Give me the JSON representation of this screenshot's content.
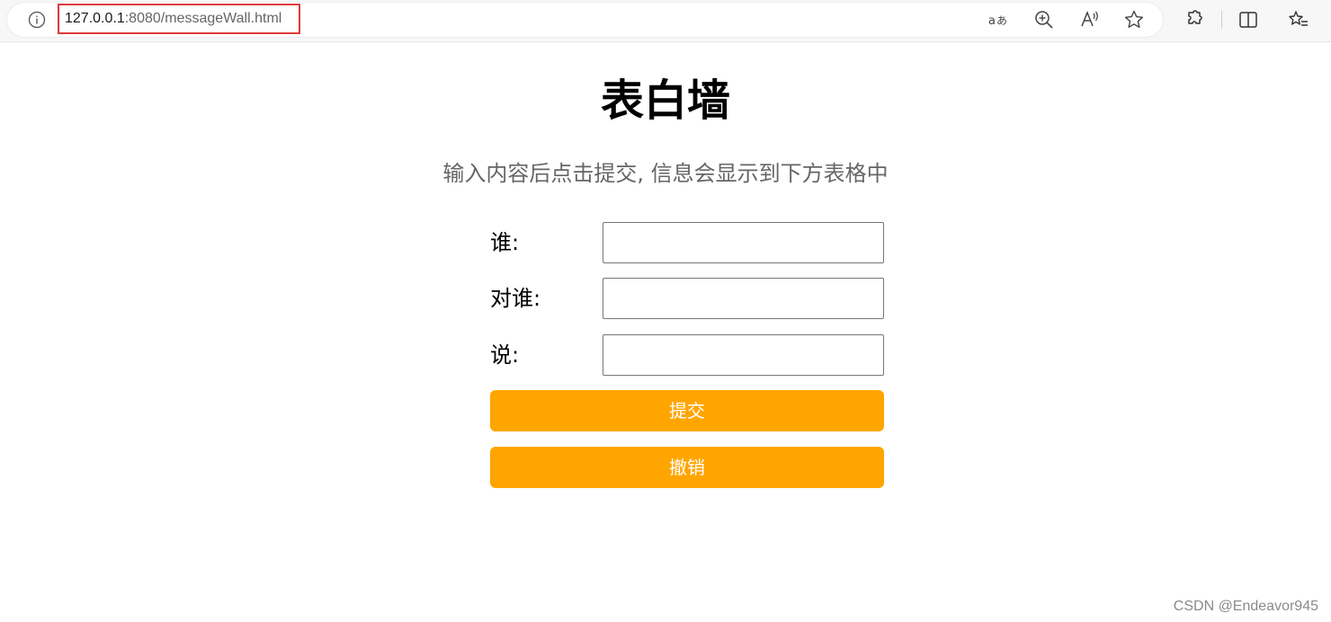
{
  "browser": {
    "url_host": "127.0.0.1",
    "url_rest": ":8080/messageWall.html",
    "url_highlight_color": "#e03a3a",
    "icons": [
      "info-icon",
      "translate-icon",
      "zoom-in-icon",
      "read-aloud-icon",
      "favorite-star-icon",
      "extensions-icon",
      "split-screen-icon",
      "favorites-list-icon"
    ]
  },
  "page": {
    "title": "表白墙",
    "subtitle": "输入内容后点击提交, 信息会显示到下方表格中"
  },
  "form": {
    "fields": [
      {
        "label": "谁:",
        "value": ""
      },
      {
        "label": "对谁:",
        "value": ""
      },
      {
        "label": "说:",
        "value": ""
      }
    ],
    "submit_label": "提交",
    "cancel_label": "撤销",
    "button_color": "#ffa500"
  },
  "watermark": "CSDN @Endeavor945"
}
